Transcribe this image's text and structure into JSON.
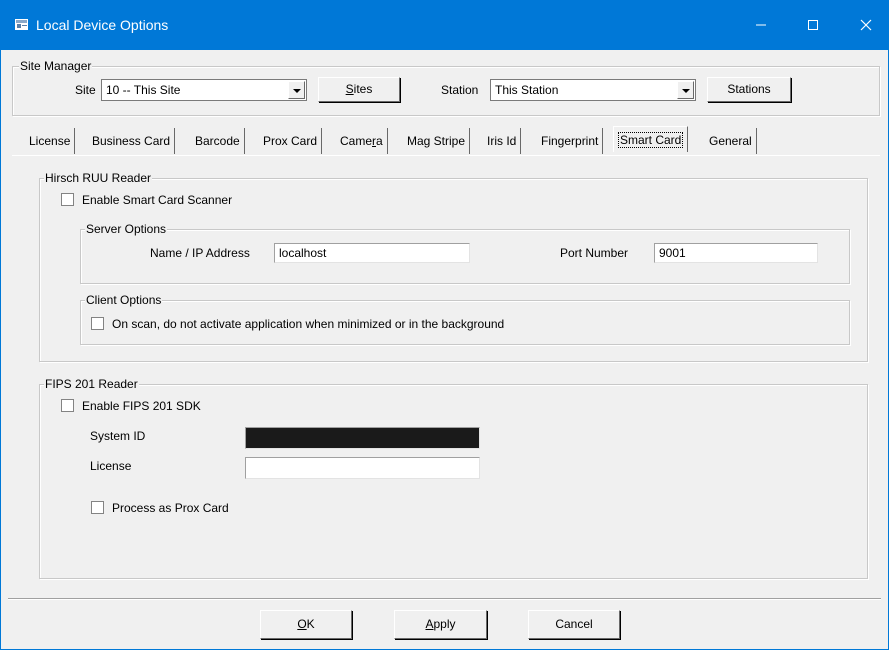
{
  "window": {
    "title": "Local Device Options",
    "min_label": "—",
    "max_label": "☐",
    "close_label": "✕"
  },
  "site_manager": {
    "title": "Site Manager",
    "site_label": "Site",
    "site_value": "10 -- This Site",
    "sites_button_first": "S",
    "sites_button_rest": "ites",
    "station_label": "Station",
    "station_value": "This Station",
    "stations_button": "Stations"
  },
  "tabs": [
    {
      "label": "License",
      "active": false
    },
    {
      "label": "Business Card",
      "active": false
    },
    {
      "label": "Barcode",
      "active": false
    },
    {
      "label": "Prox Card",
      "active": false
    },
    {
      "label": "Camera",
      "active": false
    },
    {
      "label": "Mag Stripe",
      "active": false
    },
    {
      "label": "Iris Id",
      "active": false
    },
    {
      "label": "Fingerprint",
      "active": false
    },
    {
      "label": "Smart Card",
      "active": true
    },
    {
      "label": "General",
      "active": false
    }
  ],
  "camera_tab": {
    "pre": "Came",
    "accel": "r",
    "post": "a"
  },
  "hirsch": {
    "title": "Hirsch RUU Reader",
    "enable_label": "Enable Smart Card Scanner",
    "enable_checked": false,
    "server_options": {
      "title": "Server Options",
      "name_label": "Name / IP Address",
      "name_value": "localhost",
      "port_label": "Port Number",
      "port_value": "9001"
    },
    "client_options": {
      "title": "Client Options",
      "no_activate_label": "On scan, do not activate application when minimized or in the background",
      "no_activate_checked": false
    }
  },
  "fips": {
    "title": "FIPS 201 Reader",
    "enable_label": "Enable FIPS 201 SDK",
    "enable_checked": false,
    "system_id_label": "System ID",
    "system_id_value": "",
    "license_label": "License",
    "license_value": "",
    "process_prox_label": "Process as Prox Card",
    "process_prox_checked": false
  },
  "buttons": {
    "ok_accel": "O",
    "ok_rest": "K",
    "apply_accel": "A",
    "apply_rest": "pply",
    "cancel": "Cancel"
  },
  "colors": {
    "title_bar": "#0078d7",
    "dialog_bg": "#f0f0f0",
    "redacted_field": "#1a1a1a"
  }
}
